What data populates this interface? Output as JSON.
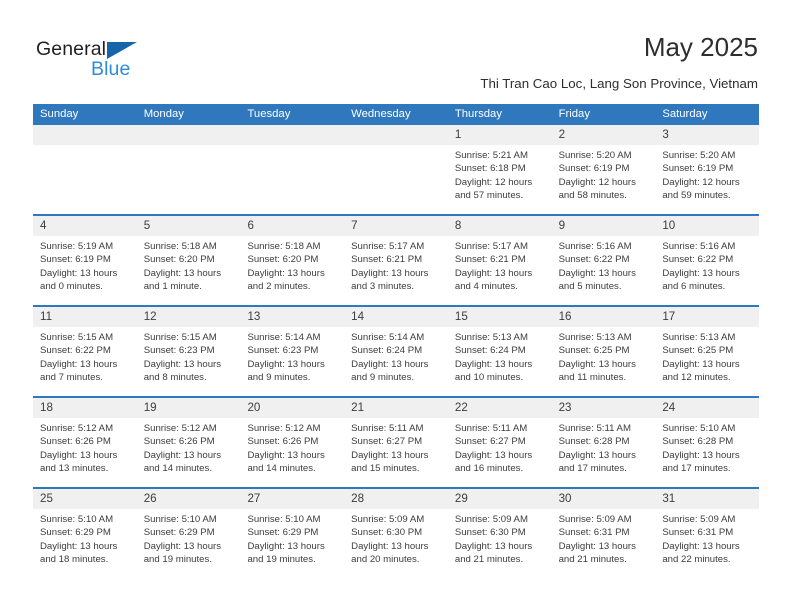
{
  "brand": {
    "name_part1": "General",
    "name_part2": "Blue",
    "triangle_color": "#1565a8",
    "blue_text_color": "#2e8bd8"
  },
  "header": {
    "title": "May 2025",
    "subtitle": "Thi Tran Cao Loc, Lang Son Province, Vietnam"
  },
  "theme": {
    "header_bar_color": "#2f78bd",
    "date_band_color": "#f0f0f0",
    "separator_color": "#2f78bd",
    "text_color": "#3d3d3d"
  },
  "calendar": {
    "weekdays": [
      "Sunday",
      "Monday",
      "Tuesday",
      "Wednesday",
      "Thursday",
      "Friday",
      "Saturday"
    ],
    "weeks": [
      [
        {
          "day": "",
          "sunrise": "",
          "sunset": "",
          "daylight": "",
          "empty": true
        },
        {
          "day": "",
          "sunrise": "",
          "sunset": "",
          "daylight": "",
          "empty": true
        },
        {
          "day": "",
          "sunrise": "",
          "sunset": "",
          "daylight": "",
          "empty": true
        },
        {
          "day": "",
          "sunrise": "",
          "sunset": "",
          "daylight": "",
          "empty": true
        },
        {
          "day": "1",
          "sunrise": "Sunrise: 5:21 AM",
          "sunset": "Sunset: 6:18 PM",
          "daylight": "Daylight: 12 hours and 57 minutes.",
          "empty": false
        },
        {
          "day": "2",
          "sunrise": "Sunrise: 5:20 AM",
          "sunset": "Sunset: 6:19 PM",
          "daylight": "Daylight: 12 hours and 58 minutes.",
          "empty": false
        },
        {
          "day": "3",
          "sunrise": "Sunrise: 5:20 AM",
          "sunset": "Sunset: 6:19 PM",
          "daylight": "Daylight: 12 hours and 59 minutes.",
          "empty": false
        }
      ],
      [
        {
          "day": "4",
          "sunrise": "Sunrise: 5:19 AM",
          "sunset": "Sunset: 6:19 PM",
          "daylight": "Daylight: 13 hours and 0 minutes.",
          "empty": false
        },
        {
          "day": "5",
          "sunrise": "Sunrise: 5:18 AM",
          "sunset": "Sunset: 6:20 PM",
          "daylight": "Daylight: 13 hours and 1 minute.",
          "empty": false
        },
        {
          "day": "6",
          "sunrise": "Sunrise: 5:18 AM",
          "sunset": "Sunset: 6:20 PM",
          "daylight": "Daylight: 13 hours and 2 minutes.",
          "empty": false
        },
        {
          "day": "7",
          "sunrise": "Sunrise: 5:17 AM",
          "sunset": "Sunset: 6:21 PM",
          "daylight": "Daylight: 13 hours and 3 minutes.",
          "empty": false
        },
        {
          "day": "8",
          "sunrise": "Sunrise: 5:17 AM",
          "sunset": "Sunset: 6:21 PM",
          "daylight": "Daylight: 13 hours and 4 minutes.",
          "empty": false
        },
        {
          "day": "9",
          "sunrise": "Sunrise: 5:16 AM",
          "sunset": "Sunset: 6:22 PM",
          "daylight": "Daylight: 13 hours and 5 minutes.",
          "empty": false
        },
        {
          "day": "10",
          "sunrise": "Sunrise: 5:16 AM",
          "sunset": "Sunset: 6:22 PM",
          "daylight": "Daylight: 13 hours and 6 minutes.",
          "empty": false
        }
      ],
      [
        {
          "day": "11",
          "sunrise": "Sunrise: 5:15 AM",
          "sunset": "Sunset: 6:22 PM",
          "daylight": "Daylight: 13 hours and 7 minutes.",
          "empty": false
        },
        {
          "day": "12",
          "sunrise": "Sunrise: 5:15 AM",
          "sunset": "Sunset: 6:23 PM",
          "daylight": "Daylight: 13 hours and 8 minutes.",
          "empty": false
        },
        {
          "day": "13",
          "sunrise": "Sunrise: 5:14 AM",
          "sunset": "Sunset: 6:23 PM",
          "daylight": "Daylight: 13 hours and 9 minutes.",
          "empty": false
        },
        {
          "day": "14",
          "sunrise": "Sunrise: 5:14 AM",
          "sunset": "Sunset: 6:24 PM",
          "daylight": "Daylight: 13 hours and 9 minutes.",
          "empty": false
        },
        {
          "day": "15",
          "sunrise": "Sunrise: 5:13 AM",
          "sunset": "Sunset: 6:24 PM",
          "daylight": "Daylight: 13 hours and 10 minutes.",
          "empty": false
        },
        {
          "day": "16",
          "sunrise": "Sunrise: 5:13 AM",
          "sunset": "Sunset: 6:25 PM",
          "daylight": "Daylight: 13 hours and 11 minutes.",
          "empty": false
        },
        {
          "day": "17",
          "sunrise": "Sunrise: 5:13 AM",
          "sunset": "Sunset: 6:25 PM",
          "daylight": "Daylight: 13 hours and 12 minutes.",
          "empty": false
        }
      ],
      [
        {
          "day": "18",
          "sunrise": "Sunrise: 5:12 AM",
          "sunset": "Sunset: 6:26 PM",
          "daylight": "Daylight: 13 hours and 13 minutes.",
          "empty": false
        },
        {
          "day": "19",
          "sunrise": "Sunrise: 5:12 AM",
          "sunset": "Sunset: 6:26 PM",
          "daylight": "Daylight: 13 hours and 14 minutes.",
          "empty": false
        },
        {
          "day": "20",
          "sunrise": "Sunrise: 5:12 AM",
          "sunset": "Sunset: 6:26 PM",
          "daylight": "Daylight: 13 hours and 14 minutes.",
          "empty": false
        },
        {
          "day": "21",
          "sunrise": "Sunrise: 5:11 AM",
          "sunset": "Sunset: 6:27 PM",
          "daylight": "Daylight: 13 hours and 15 minutes.",
          "empty": false
        },
        {
          "day": "22",
          "sunrise": "Sunrise: 5:11 AM",
          "sunset": "Sunset: 6:27 PM",
          "daylight": "Daylight: 13 hours and 16 minutes.",
          "empty": false
        },
        {
          "day": "23",
          "sunrise": "Sunrise: 5:11 AM",
          "sunset": "Sunset: 6:28 PM",
          "daylight": "Daylight: 13 hours and 17 minutes.",
          "empty": false
        },
        {
          "day": "24",
          "sunrise": "Sunrise: 5:10 AM",
          "sunset": "Sunset: 6:28 PM",
          "daylight": "Daylight: 13 hours and 17 minutes.",
          "empty": false
        }
      ],
      [
        {
          "day": "25",
          "sunrise": "Sunrise: 5:10 AM",
          "sunset": "Sunset: 6:29 PM",
          "daylight": "Daylight: 13 hours and 18 minutes.",
          "empty": false
        },
        {
          "day": "26",
          "sunrise": "Sunrise: 5:10 AM",
          "sunset": "Sunset: 6:29 PM",
          "daylight": "Daylight: 13 hours and 19 minutes.",
          "empty": false
        },
        {
          "day": "27",
          "sunrise": "Sunrise: 5:10 AM",
          "sunset": "Sunset: 6:29 PM",
          "daylight": "Daylight: 13 hours and 19 minutes.",
          "empty": false
        },
        {
          "day": "28",
          "sunrise": "Sunrise: 5:09 AM",
          "sunset": "Sunset: 6:30 PM",
          "daylight": "Daylight: 13 hours and 20 minutes.",
          "empty": false
        },
        {
          "day": "29",
          "sunrise": "Sunrise: 5:09 AM",
          "sunset": "Sunset: 6:30 PM",
          "daylight": "Daylight: 13 hours and 21 minutes.",
          "empty": false
        },
        {
          "day": "30",
          "sunrise": "Sunrise: 5:09 AM",
          "sunset": "Sunset: 6:31 PM",
          "daylight": "Daylight: 13 hours and 21 minutes.",
          "empty": false
        },
        {
          "day": "31",
          "sunrise": "Sunrise: 5:09 AM",
          "sunset": "Sunset: 6:31 PM",
          "daylight": "Daylight: 13 hours and 22 minutes.",
          "empty": false
        }
      ]
    ]
  }
}
